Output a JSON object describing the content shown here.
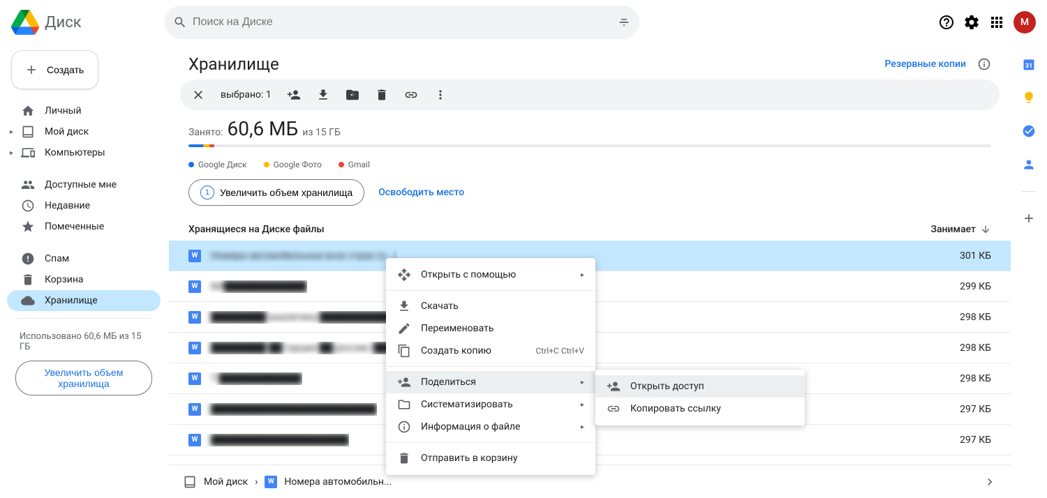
{
  "header": {
    "app_name": "Диск",
    "search_placeholder": "Поиск на Диске",
    "avatar_initial": "М"
  },
  "sidebar": {
    "create_label": "Создать",
    "items": [
      {
        "label": "Личный",
        "icon": "home",
        "has_chevron": false
      },
      {
        "label": "Мой диск",
        "icon": "drive",
        "has_chevron": true
      },
      {
        "label": "Компьютеры",
        "icon": "devices",
        "has_chevron": true
      }
    ],
    "items2": [
      {
        "label": "Доступные мне",
        "icon": "shared"
      },
      {
        "label": "Недавние",
        "icon": "clock"
      },
      {
        "label": "Помеченные",
        "icon": "star"
      }
    ],
    "items3": [
      {
        "label": "Спам",
        "icon": "spam"
      },
      {
        "label": "Корзина",
        "icon": "trash"
      },
      {
        "label": "Хранилище",
        "icon": "cloud",
        "selected": true
      }
    ],
    "storage_text": "Использовано 60,6 МБ из 15 ГБ",
    "upgrade_label": "Увеличить объем хранилища"
  },
  "main": {
    "title": "Хранилище",
    "backup_link": "Резервные копии",
    "selection_label": "выбрано: 1",
    "storage": {
      "used_label": "Занято:",
      "used_value": "60,6 МБ",
      "total_label": "из 15 ГБ",
      "legend": [
        "Google Диск",
        "Google Фото",
        "Gmail"
      ],
      "colors": [
        "#1a73e8",
        "#fbbc04",
        "#ea4335"
      ],
      "upgrade_btn": "Увеличить объем хранилища",
      "free_link": "Освободить место"
    },
    "table": {
      "name_header": "Хранящиеся на Диске файлы",
      "size_header": "Занимает",
      "rows": [
        {
          "name": "Номера автомобильные всех стран (о...)",
          "size": "301 КБ",
          "selected": true
        },
        {
          "name": "БИ████████████",
          "size": "299 КБ"
        },
        {
          "name": "████████ аналитика ████████████",
          "size": "298 КБ"
        },
        {
          "name": "████████ ██ турции ██ россии (████████",
          "size": "298 КБ"
        },
        {
          "name": "Т ████████████",
          "size": "298 КБ"
        },
        {
          "name": "████████████████████████",
          "size": "297 КБ"
        },
        {
          "name": "████████████████████",
          "size": "297 КБ"
        }
      ]
    }
  },
  "context_menu": {
    "items": [
      {
        "label": "Открыть с помощью",
        "icon": "open-with",
        "arrow": true
      },
      {
        "sep": true
      },
      {
        "label": "Скачать",
        "icon": "download"
      },
      {
        "label": "Переименовать",
        "icon": "rename"
      },
      {
        "label": "Создать копию",
        "icon": "copy",
        "shortcut": "Ctrl+C Ctrl+V"
      },
      {
        "sep": true
      },
      {
        "label": "Поделиться",
        "icon": "share",
        "arrow": true,
        "hover": true
      },
      {
        "label": "Систематизировать",
        "icon": "organize",
        "arrow": true
      },
      {
        "label": "Информация о файле",
        "icon": "info",
        "arrow": true
      },
      {
        "sep": true
      },
      {
        "label": "Отправить в корзину",
        "icon": "trash"
      }
    ],
    "submenu": [
      {
        "label": "Открыть доступ",
        "icon": "person-add",
        "hover": true
      },
      {
        "label": "Копировать ссылку",
        "icon": "link"
      }
    ]
  },
  "breadcrumb": {
    "root": "Мой диск",
    "file": "Номера автомобильн..."
  }
}
